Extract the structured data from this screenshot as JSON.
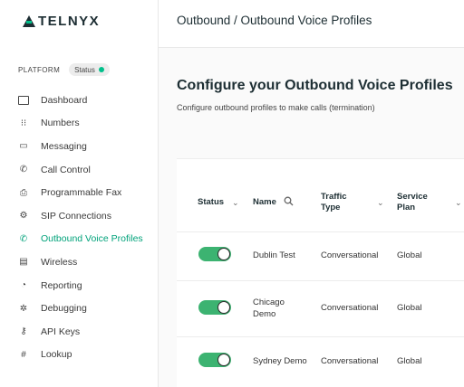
{
  "brand": {
    "name": "TELNYX"
  },
  "sidebar": {
    "platform_label": "PLATFORM",
    "status_label": "Status",
    "items": [
      {
        "label": "Dashboard",
        "icon": "dashboard-icon"
      },
      {
        "label": "Numbers",
        "icon": "numbers-icon"
      },
      {
        "label": "Messaging",
        "icon": "messaging-icon"
      },
      {
        "label": "Call Control",
        "icon": "call-control-icon"
      },
      {
        "label": "Programmable Fax",
        "icon": "fax-icon"
      },
      {
        "label": "SIP Connections",
        "icon": "sip-icon"
      },
      {
        "label": "Outbound Voice Profiles",
        "icon": "outbound-voice-icon",
        "active": true
      },
      {
        "label": "Wireless",
        "icon": "wireless-icon"
      },
      {
        "label": "Reporting",
        "icon": "reporting-icon"
      },
      {
        "label": "Debugging",
        "icon": "debugging-icon"
      },
      {
        "label": "API Keys",
        "icon": "api-keys-icon"
      },
      {
        "label": "Lookup",
        "icon": "lookup-icon"
      }
    ]
  },
  "header": {
    "breadcrumb": "Outbound / Outbound Voice Profiles"
  },
  "main": {
    "title": "Configure your Outbound Voice Profiles",
    "subtitle": "Configure outbound profiles to make calls (termination)"
  },
  "table": {
    "columns": {
      "status": "Status",
      "name": "Name",
      "traffic_1": "Traffic",
      "traffic_2": "Type",
      "plan_1": "Service",
      "plan_2": "Plan"
    },
    "rows": [
      {
        "enabled": true,
        "name_1": "Dublin Test",
        "name_2": "",
        "traffic": "Conversational",
        "plan": "Global"
      },
      {
        "enabled": true,
        "name_1": "Chicago",
        "name_2": "Demo",
        "traffic": "Conversational",
        "plan": "Global"
      },
      {
        "enabled": true,
        "name_1": "Sydney Demo",
        "name_2": "",
        "traffic": "Conversational",
        "plan": "Global"
      }
    ]
  },
  "colors": {
    "accent": "#00a27a",
    "toggle_on": "#3cb371"
  }
}
